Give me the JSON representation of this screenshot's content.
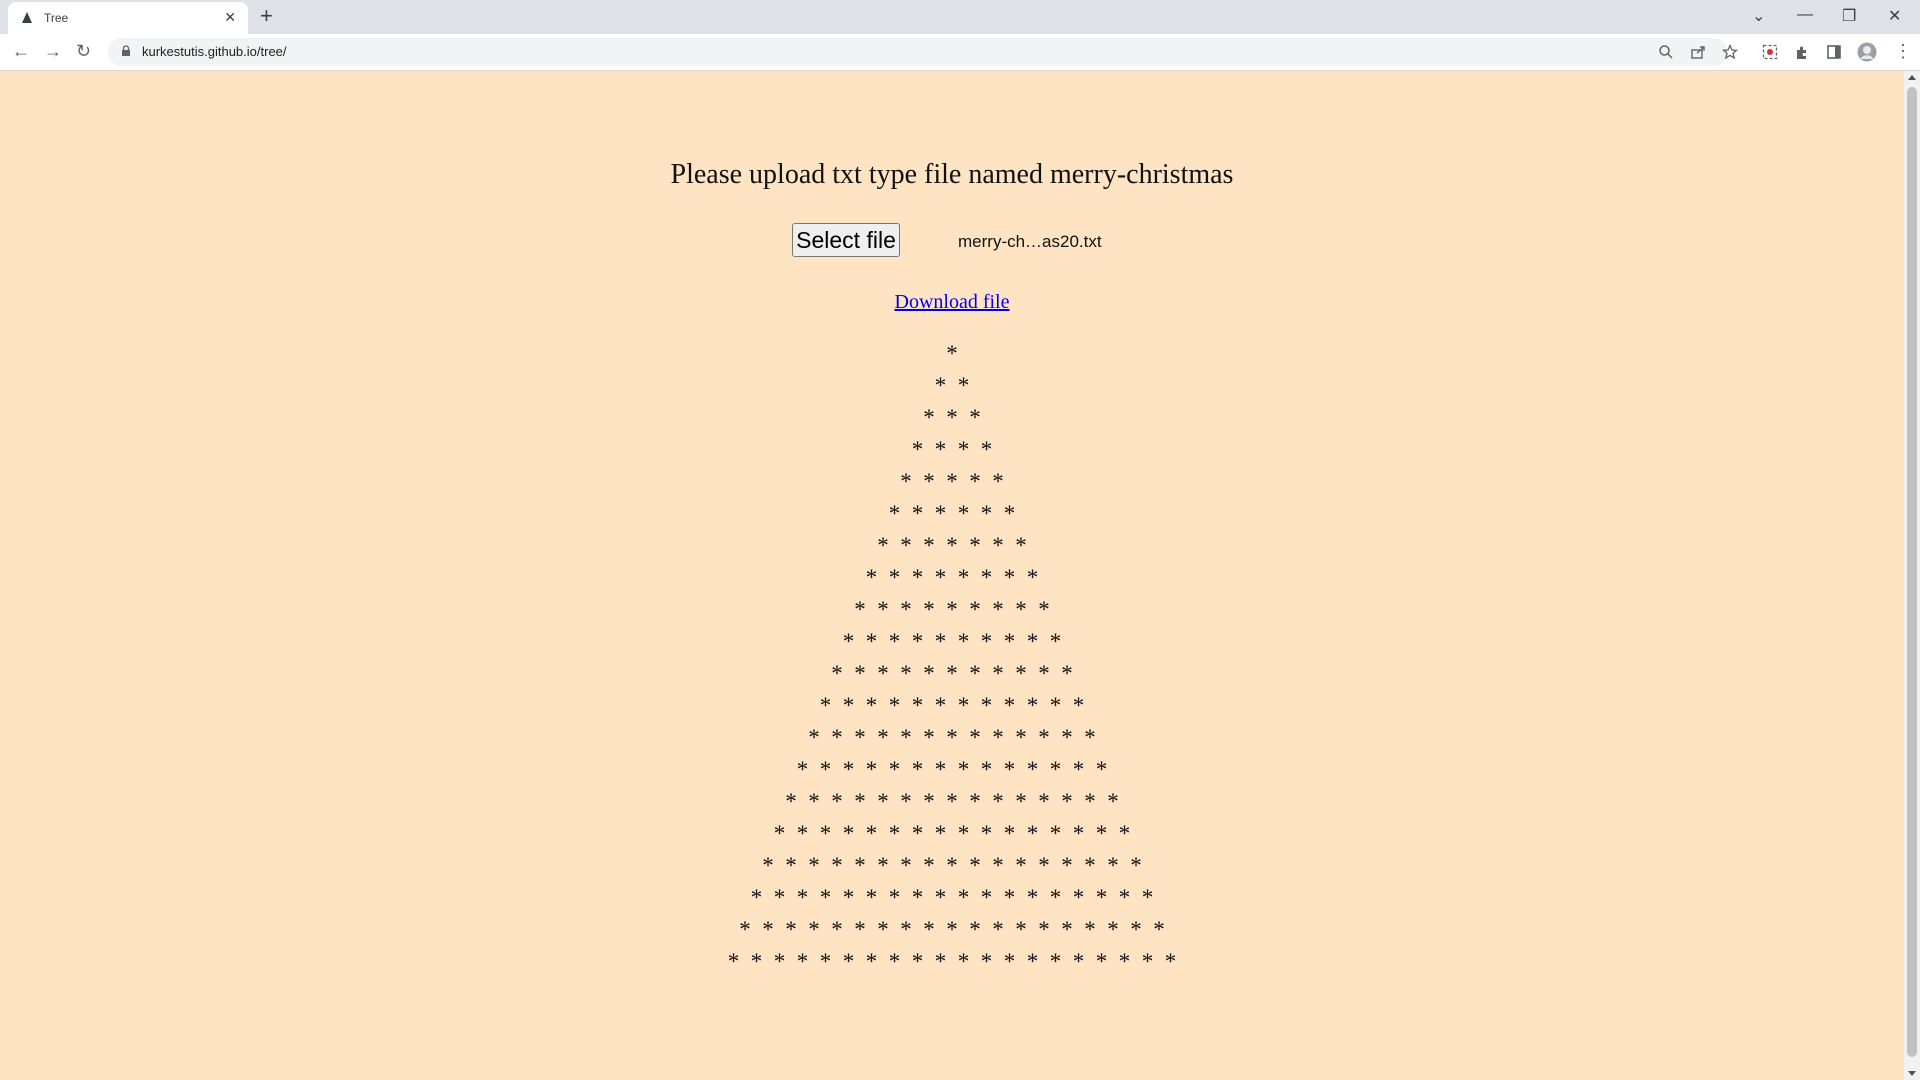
{
  "browser": {
    "tab_title": "Tree",
    "url": "kurkestutis.github.io/tree/"
  },
  "page": {
    "heading": "Please upload txt type file named merry-christmas",
    "select_file_label": "Select file",
    "file_name": "merry-ch…as20.txt",
    "download_label": "Download file",
    "tree_rows": 20,
    "tree_symbol": "*"
  },
  "colors": {
    "page_background": "#ffe4c4",
    "link": "#0000ee"
  },
  "icons": [
    "tree-favicon",
    "close-icon",
    "plus-icon",
    "back-icon",
    "forward-icon",
    "reload-icon",
    "lock-icon",
    "zoom-icon",
    "share-icon",
    "star-icon",
    "screenshot-icon",
    "extensions-icon",
    "sidepanel-icon",
    "profile-avatar",
    "menu-icon"
  ]
}
